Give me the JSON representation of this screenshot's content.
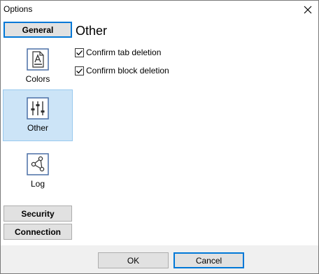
{
  "window": {
    "title": "Options"
  },
  "sidebar": {
    "groups_top": [
      {
        "label": "General",
        "active": true
      }
    ],
    "categories": [
      {
        "label": "Colors",
        "icon": "font-color-icon",
        "selected": false
      },
      {
        "label": "Other",
        "icon": "sliders-icon",
        "selected": true
      },
      {
        "label": "Log",
        "icon": "nodes-icon",
        "selected": false
      }
    ],
    "groups_bottom": [
      {
        "label": "Security"
      },
      {
        "label": "Connection"
      }
    ]
  },
  "content": {
    "title": "Other",
    "options": [
      {
        "label": "Confirm tab deletion",
        "checked": true
      },
      {
        "label": "Confirm block deletion",
        "checked": true
      }
    ]
  },
  "footer": {
    "ok_label": "OK",
    "cancel_label": "Cancel"
  },
  "colors": {
    "selection_bg": "#cce4f7",
    "focus_border": "#0078d7",
    "icon_stroke": "#4a6fa5"
  }
}
